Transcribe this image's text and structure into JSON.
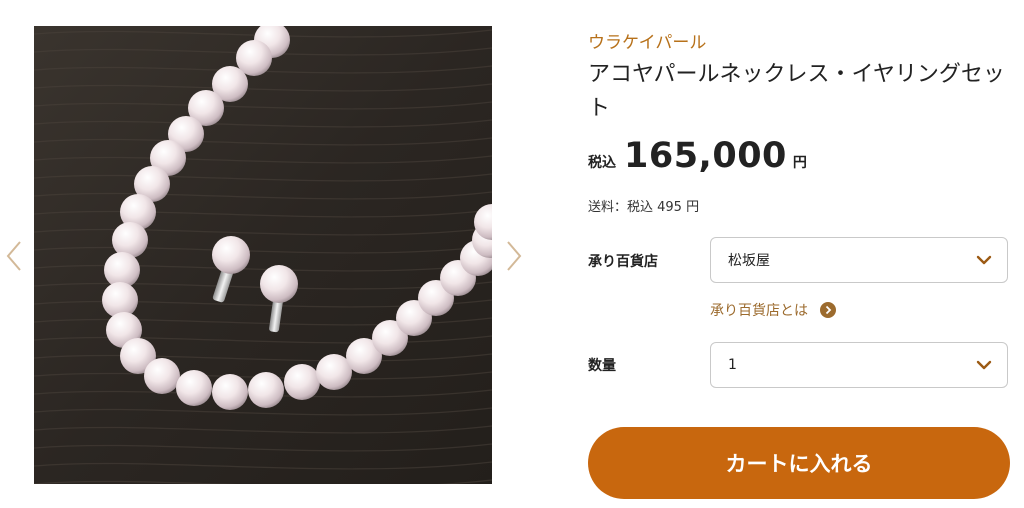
{
  "product": {
    "brand": "ウラケイパール",
    "title": "アコヤパールネックレス・イヤリングセット",
    "tax_label": "税込",
    "price": "165,000",
    "currency": "円",
    "shipping": "送料：税込 495 円"
  },
  "store_field": {
    "label": "承り百貨店",
    "selected": "松坂屋",
    "help_link": "承り百貨店とは"
  },
  "quantity_field": {
    "label": "数量",
    "selected": "1"
  },
  "cart_button": {
    "label": "カートに入れる"
  },
  "icons": {
    "gallery_prev": "chevron-left-icon",
    "gallery_next": "chevron-right-icon",
    "select_arrow": "chevron-down-icon",
    "help": "circle-arrow-right-icon"
  },
  "colors": {
    "accent": "#c8670e",
    "brand_text": "#b7711a",
    "link_text": "#9c6b2e",
    "gallery_arrow": "#d3b998"
  }
}
